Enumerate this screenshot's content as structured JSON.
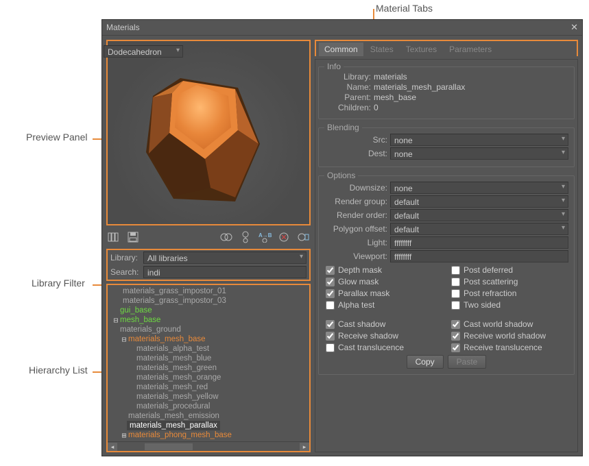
{
  "callouts": {
    "preview": "Preview Panel",
    "tabs": "Material Tabs",
    "filter": "Library Filter",
    "hierarchy": "Hierarchy List"
  },
  "window": {
    "title": "Materials"
  },
  "preview": {
    "shape": "Dodecahedron"
  },
  "filter": {
    "library_label": "Library:",
    "library_value": "All libraries",
    "search_label": "Search:",
    "search_value": "indi"
  },
  "tree": [
    {
      "indent": "indent-0",
      "label": "materials_grass_impostor_01",
      "cls": ""
    },
    {
      "indent": "indent-0",
      "label": "materials_grass_impostor_03",
      "cls": ""
    },
    {
      "indent": "indent-1",
      "label": "gui_base",
      "cls": "green",
      "expand": " "
    },
    {
      "indent": "indent-1",
      "label": "mesh_base",
      "cls": "green",
      "expand": "⊟"
    },
    {
      "indent": "indent-1b",
      "label": "materials_ground",
      "cls": ""
    },
    {
      "indent": "indent-1b",
      "label": "materials_mesh_base",
      "cls": "orange",
      "expand": "⊟"
    },
    {
      "indent": "indent-3",
      "label": "materials_alpha_test",
      "cls": ""
    },
    {
      "indent": "indent-3",
      "label": "materials_mesh_blue",
      "cls": ""
    },
    {
      "indent": "indent-3",
      "label": "materials_mesh_green",
      "cls": ""
    },
    {
      "indent": "indent-3",
      "label": "materials_mesh_orange",
      "cls": ""
    },
    {
      "indent": "indent-3",
      "label": "materials_mesh_red",
      "cls": ""
    },
    {
      "indent": "indent-3",
      "label": "materials_mesh_yellow",
      "cls": ""
    },
    {
      "indent": "indent-3",
      "label": "materials_procedural",
      "cls": ""
    },
    {
      "indent": "indent-2",
      "label": "materials_mesh_emission",
      "cls": ""
    },
    {
      "indent": "indent-2",
      "label": "materials_mesh_parallax",
      "cls": "",
      "selected": true
    },
    {
      "indent": "indent-1b",
      "label": "materials_phong_mesh_base",
      "cls": "orange",
      "expand": "⊞"
    }
  ],
  "tabs": [
    "Common",
    "States",
    "Textures",
    "Parameters"
  ],
  "info": {
    "title": "Info",
    "library_k": "Library:",
    "library_v": "materials",
    "name_k": "Name:",
    "name_v": "materials_mesh_parallax",
    "parent_k": "Parent:",
    "parent_v": "mesh_base",
    "children_k": "Children:",
    "children_v": "0"
  },
  "blending": {
    "title": "Blending",
    "src_k": "Src:",
    "src_v": "none",
    "dest_k": "Dest:",
    "dest_v": "none"
  },
  "options": {
    "title": "Options",
    "downsize_k": "Downsize:",
    "downsize_v": "none",
    "rgroup_k": "Render group:",
    "rgroup_v": "default",
    "rorder_k": "Render order:",
    "rorder_v": "default",
    "poffset_k": "Polygon offset:",
    "poffset_v": "default",
    "light_k": "Light:",
    "light_v": "ffffffff",
    "viewport_k": "Viewport:",
    "viewport_v": "ffffffff"
  },
  "checks1": [
    {
      "label": "Depth mask",
      "checked": true
    },
    {
      "label": "Post deferred",
      "checked": false
    },
    {
      "label": "Glow mask",
      "checked": true
    },
    {
      "label": "Post scattering",
      "checked": false
    },
    {
      "label": "Parallax mask",
      "checked": true
    },
    {
      "label": "Post refraction",
      "checked": false
    },
    {
      "label": "Alpha test",
      "checked": false
    },
    {
      "label": "Two sided",
      "checked": false
    }
  ],
  "checks2": [
    {
      "label": "Cast shadow",
      "checked": true
    },
    {
      "label": "Cast world shadow",
      "checked": true
    },
    {
      "label": "Receive shadow",
      "checked": true
    },
    {
      "label": "Receive world shadow",
      "checked": true
    },
    {
      "label": "Cast translucence",
      "checked": false
    },
    {
      "label": "Receive translucence",
      "checked": true
    }
  ],
  "buttons": {
    "copy": "Copy",
    "paste": "Paste"
  }
}
